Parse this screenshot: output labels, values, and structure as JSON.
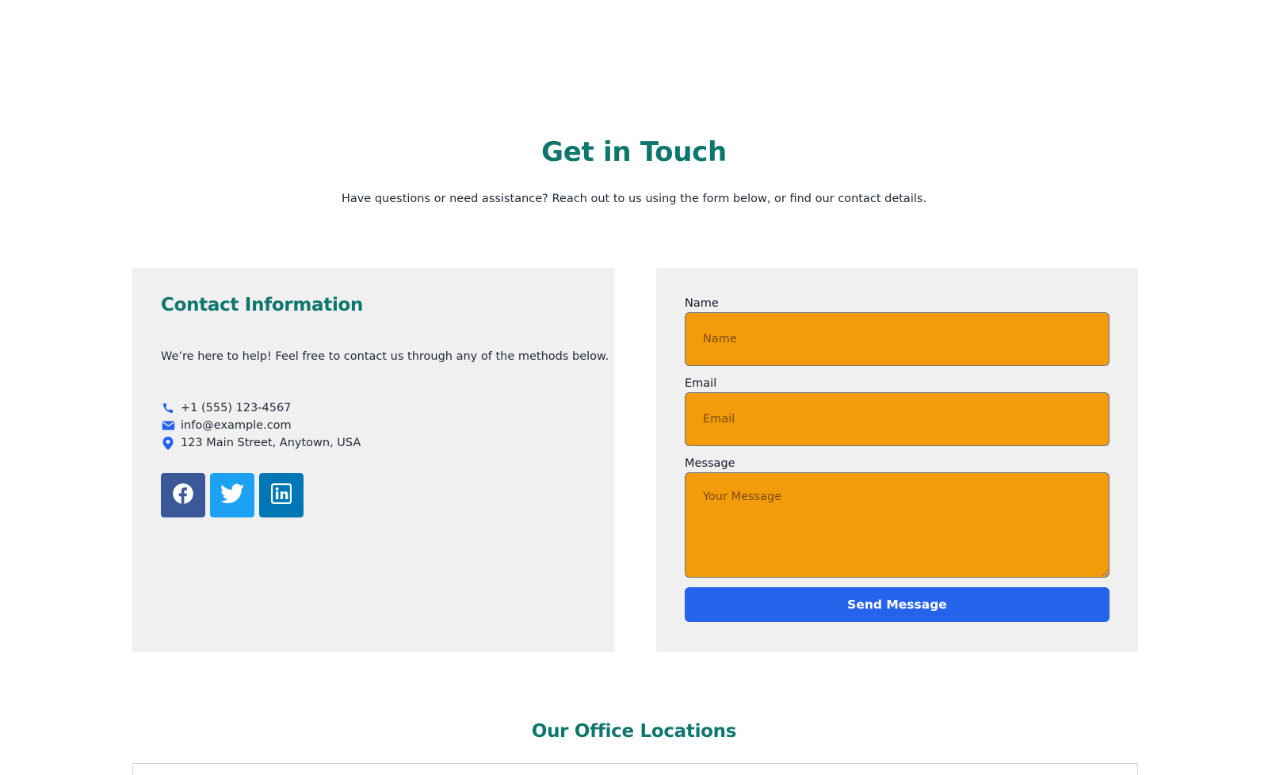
{
  "hero": {
    "title": "Get in Touch",
    "subtitle": "Have questions or need assistance? Reach out to us using the form below, or find our contact details."
  },
  "contact_info": {
    "title": "Contact Information",
    "description": "We’re here to help! Feel free to contact us through any of the methods below.",
    "items": [
      {
        "icon": "phone-icon",
        "text": "+1 (555) 123-4567"
      },
      {
        "icon": "envelope-icon",
        "text": "info@example.com"
      },
      {
        "icon": "map-pin-icon",
        "text": "123 Main Street, Anytown, USA"
      }
    ],
    "social": [
      {
        "icon": "facebook-icon",
        "color": "#3b5998"
      },
      {
        "icon": "twitter-icon",
        "color": "#1da1f2"
      },
      {
        "icon": "linkedin-icon",
        "color": "#0077b5"
      }
    ]
  },
  "form": {
    "name_label": "Name",
    "name_placeholder": "Name",
    "email_label": "Email",
    "email_placeholder": "Email",
    "message_label": "Message",
    "message_placeholder": "Your Message",
    "submit_label": "Send Message"
  },
  "locations": {
    "title": "Our Office Locations"
  },
  "colors": {
    "heading": "#0f766e",
    "input_bg": "#f39c0b",
    "button_bg": "#2563eb",
    "icon_blue": "#2563eb",
    "panel_bg": "#f0f0f0"
  }
}
